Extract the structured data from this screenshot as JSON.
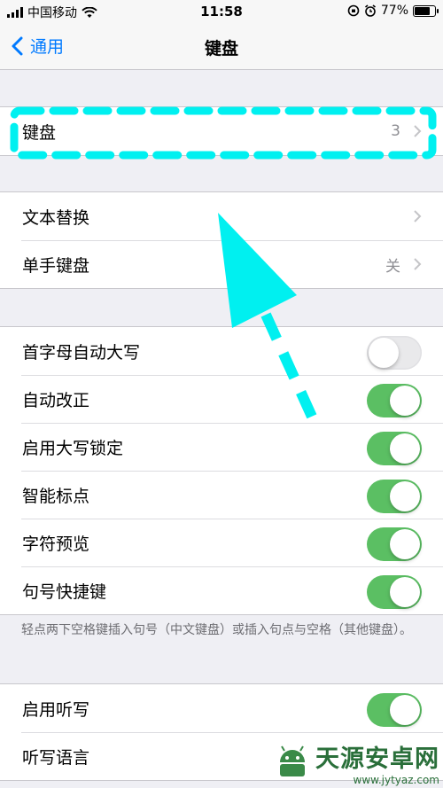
{
  "status_bar": {
    "carrier": "中国移动",
    "time": "11:58",
    "battery": "77%"
  },
  "nav": {
    "back_label": "通用",
    "title": "键盘"
  },
  "group_keyboards": {
    "label": "键盘",
    "value": "3"
  },
  "group_text": {
    "rows": [
      {
        "label": "文本替换",
        "value": ""
      },
      {
        "label": "单手键盘",
        "value": "关"
      }
    ]
  },
  "group_toggles": {
    "rows": [
      {
        "label": "首字母自动大写",
        "on": false
      },
      {
        "label": "自动改正",
        "on": true
      },
      {
        "label": "启用大写锁定",
        "on": true
      },
      {
        "label": "智能标点",
        "on": true
      },
      {
        "label": "字符预览",
        "on": true
      },
      {
        "label": "句号快捷键",
        "on": true
      }
    ],
    "footnote": "轻点两下空格键插入句号（中文键盘）或插入句点与空格（其他键盘）。"
  },
  "group_dictation": {
    "rows": [
      {
        "label": "启用听写",
        "on": true
      },
      {
        "label": "听写语言",
        "value": ""
      }
    ]
  },
  "watermark": {
    "title": "天源安卓网",
    "url": "www.jytyaz.com"
  },
  "colors": {
    "accent": "#007aff",
    "toggle_on": "#5bbf63",
    "highlight": "#00f0f0"
  }
}
